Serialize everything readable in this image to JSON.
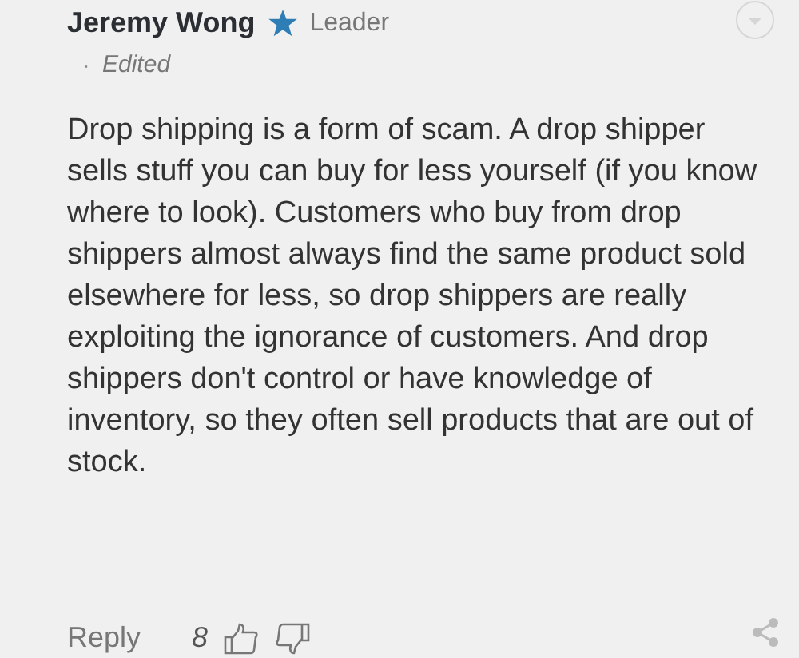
{
  "comment": {
    "author": "Jeremy Wong",
    "badge": "Leader",
    "edited": "Edited",
    "separator": "·",
    "body": "Drop shipping is a form of scam.  A drop shipper sells stuff you can buy for less yourself (if you know where to look). Customers who buy from drop shippers almost always find the same product sold elsewhere for less, so drop shippers are really exploiting the ignorance of customers.  And drop shippers don't control or have knowledge of inventory, so they often sell products that are out of stock.",
    "reply": "Reply",
    "likes": "8"
  }
}
